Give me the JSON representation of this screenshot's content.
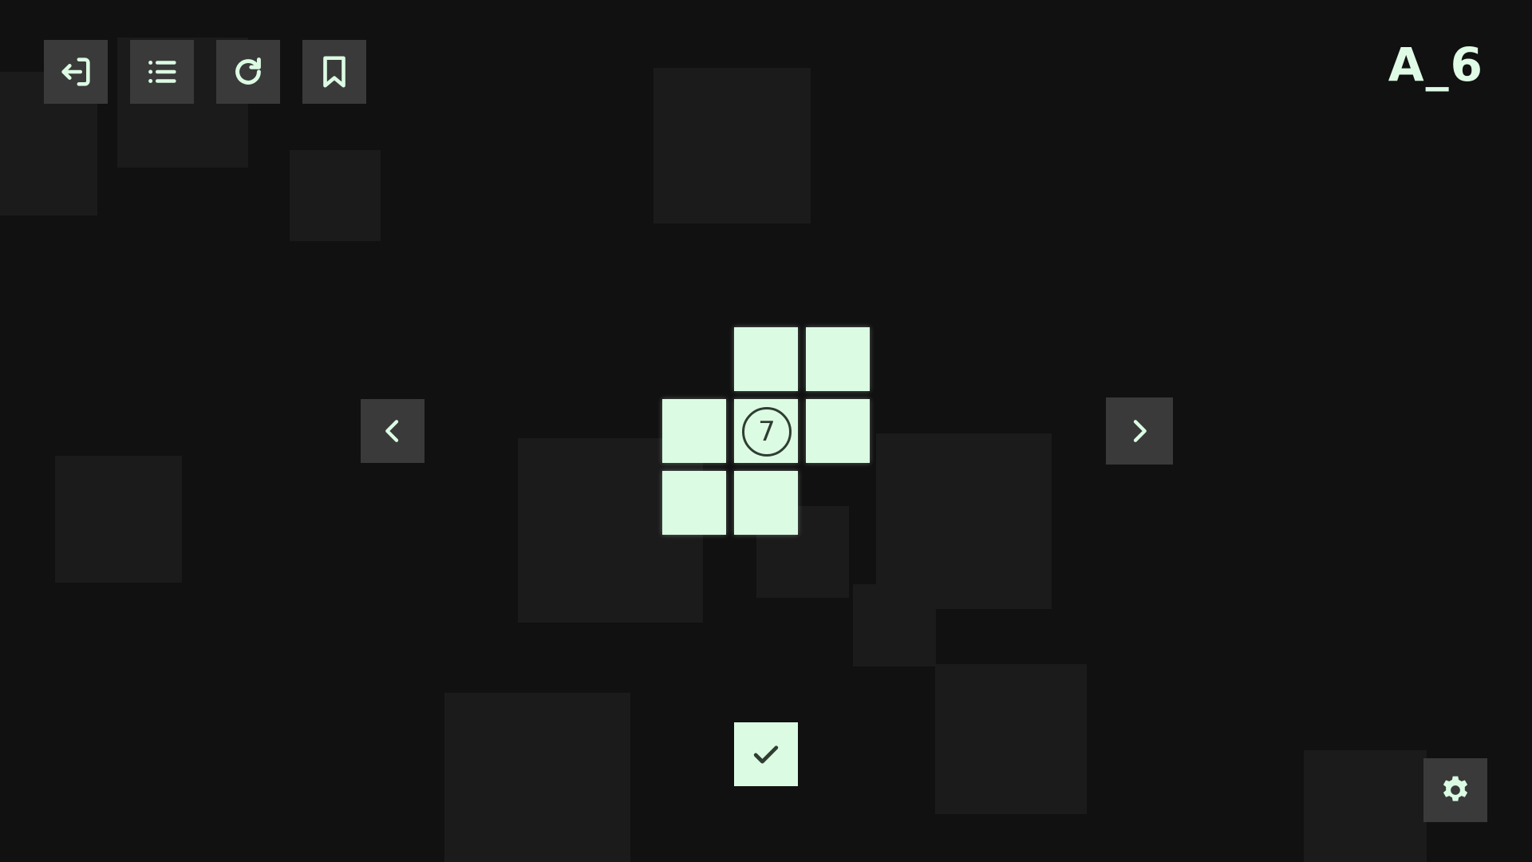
{
  "header": {
    "level_name": "A_6"
  },
  "toolbar": {
    "buttons": [
      {
        "id": "exit",
        "icon": "exit-icon"
      },
      {
        "id": "level-list",
        "icon": "list-icon"
      },
      {
        "id": "restart",
        "icon": "restart-icon"
      },
      {
        "id": "bookmark",
        "icon": "bookmark-icon"
      }
    ]
  },
  "navigation": {
    "prev_icon": "chevron-left-icon",
    "next_icon": "chevron-right-icon"
  },
  "puzzle": {
    "grid_rows": 3,
    "grid_cols": 3,
    "filled_cells": [
      [
        0,
        1
      ],
      [
        0,
        2
      ],
      [
        1,
        0
      ],
      [
        1,
        1
      ],
      [
        1,
        2
      ],
      [
        2,
        0
      ],
      [
        2,
        1
      ]
    ],
    "clues": [
      {
        "row": 1,
        "col": 1,
        "value": "7"
      }
    ]
  },
  "actions": {
    "submit_icon": "check-icon",
    "settings_icon": "gear-icon"
  },
  "colors": {
    "background": "#111111",
    "accent": "#dcfbe3",
    "button_bg": "#3a3a3a",
    "decor_square": "#1b1b1b",
    "clue_ink": "#2f3d33"
  }
}
